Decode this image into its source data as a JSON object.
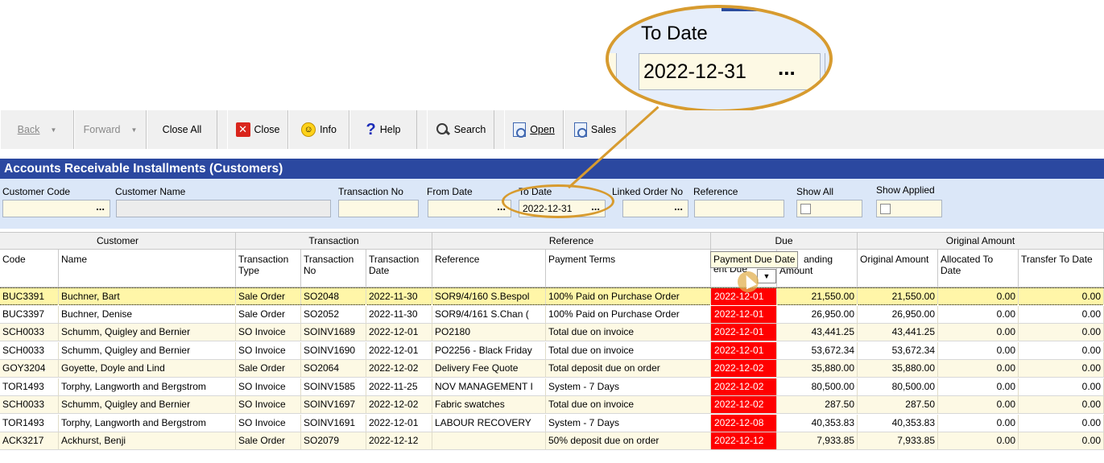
{
  "callout": {
    "label": "To Date",
    "value": "2022-12-31",
    "button": "..."
  },
  "toolbar": {
    "back": "Back",
    "forward": "Forward",
    "close_all": "Close All",
    "close": "Close",
    "info": "Info",
    "help": "Help",
    "search": "Search",
    "open": "Open",
    "sales": "Sales"
  },
  "title": "Accounts Receivable Installments (Customers)",
  "filters": {
    "customer_code": {
      "label": "Customer Code",
      "value": "",
      "button": "..."
    },
    "customer_name": {
      "label": "Customer Name",
      "value": ""
    },
    "transaction_no": {
      "label": "Transaction No",
      "value": ""
    },
    "from_date": {
      "label": "From Date",
      "value": "",
      "button": "..."
    },
    "to_date": {
      "label": "To Date",
      "value": "2022-12-31",
      "button": "..."
    },
    "linked_order_no": {
      "label": "Linked Order No",
      "value": "",
      "button": "..."
    },
    "reference": {
      "label": "Reference",
      "value": ""
    },
    "show_all": {
      "label": "Show All",
      "checked": false
    },
    "show_applied": {
      "label": "Show Applied",
      "checked": false
    }
  },
  "grid": {
    "groups": [
      "Customer",
      "Transaction",
      "Reference",
      "Due",
      "Original Amount"
    ],
    "headers": [
      "Code",
      "Name",
      "Transaction Type",
      "Transaction No",
      "Transaction Date",
      "Reference",
      "Payment Terms",
      "ent Due",
      "Amount",
      "Original Amount",
      "Allocated To Date",
      "Transfer To Date"
    ],
    "outstanding_header_fragment": "anding",
    "tooltip": "Payment Due Date",
    "rows": [
      [
        "BUC3391",
        "Buchner, Bart",
        "Sale Order",
        "SO2048",
        "2022-11-30",
        "SOR9/4/160 S.Bespol",
        "100% Paid on Purchase Order",
        "2022-12-01",
        "21,550.00",
        "21,550.00",
        "0.00",
        "0.00"
      ],
      [
        "BUC3397",
        "Buchner, Denise",
        "Sale Order",
        "SO2052",
        "2022-11-30",
        "SOR9/4/161 S.Chan (",
        "100% Paid on Purchase Order",
        "2022-12-01",
        "26,950.00",
        "26,950.00",
        "0.00",
        "0.00"
      ],
      [
        "SCH0033",
        "Schumm, Quigley and Bernier",
        "SO Invoice",
        "SOINV1689",
        "2022-12-01",
        "PO2180",
        "Total due on invoice",
        "2022-12-01",
        "43,441.25",
        "43,441.25",
        "0.00",
        "0.00"
      ],
      [
        "SCH0033",
        "Schumm, Quigley and Bernier",
        "SO Invoice",
        "SOINV1690",
        "2022-12-01",
        "PO2256 - Black Friday",
        "Total due on invoice",
        "2022-12-01",
        "53,672.34",
        "53,672.34",
        "0.00",
        "0.00"
      ],
      [
        "GOY3204",
        "Goyette, Doyle and Lind",
        "Sale Order",
        "SO2064",
        "2022-12-02",
        "Delivery Fee Quote",
        "Total deposit due on order",
        "2022-12-02",
        "35,880.00",
        "35,880.00",
        "0.00",
        "0.00"
      ],
      [
        "TOR1493",
        "Torphy, Langworth and Bergstrom",
        "SO Invoice",
        "SOINV1585",
        "2022-11-25",
        "NOV MANAGEMENT I",
        "System - 7 Days",
        "2022-12-02",
        "80,500.00",
        "80,500.00",
        "0.00",
        "0.00"
      ],
      [
        "SCH0033",
        "Schumm, Quigley and Bernier",
        "SO Invoice",
        "SOINV1697",
        "2022-12-02",
        "Fabric swatches",
        "Total due on invoice",
        "2022-12-02",
        "287.50",
        "287.50",
        "0.00",
        "0.00"
      ],
      [
        "TOR1493",
        "Torphy, Langworth and Bergstrom",
        "SO Invoice",
        "SOINV1691",
        "2022-12-01",
        "LABOUR RECOVERY",
        "System - 7 Days",
        "2022-12-08",
        "40,353.83",
        "40,353.83",
        "0.00",
        "0.00"
      ],
      [
        "ACK3217",
        "Ackhurst, Benji",
        "Sale Order",
        "SO2079",
        "2022-12-12",
        "",
        "50% deposit due on order",
        "2022-12-12",
        "7,933.85",
        "7,933.85",
        "0.00",
        "0.00"
      ]
    ]
  },
  "colors": {
    "title_bar": "#2b48a0",
    "due_highlight": "#ff0000",
    "callout": "#d79b2f",
    "filter_bg": "#dbe7f8",
    "row_alt": "#fdf9e4"
  }
}
